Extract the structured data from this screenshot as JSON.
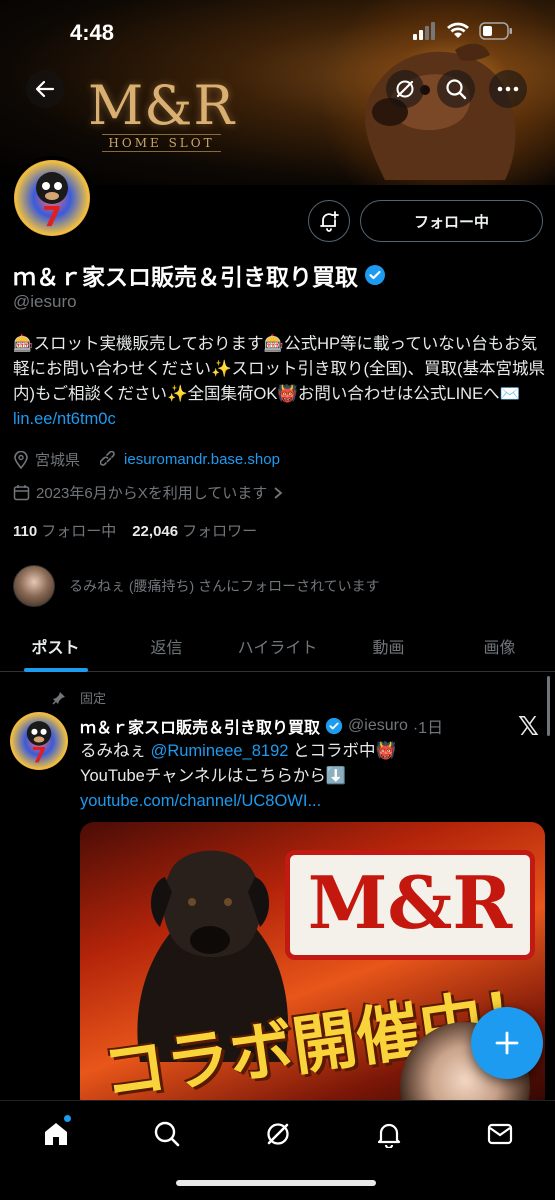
{
  "status_bar": {
    "time": "4:48",
    "battery_icon": "battery-icon",
    "wifi_icon": "wifi-icon",
    "signal_icon": "signal-icon"
  },
  "banner": {
    "logo_main": "M&R",
    "logo_sub": "HOME SLOT"
  },
  "profile": {
    "display_name": "ｍ＆ｒ家スロ販売＆引き取り買取",
    "handle": "@iesuro",
    "following_button": "フォロー中",
    "bio_line1": "🎰スロット実機販売しております🎰公式HP等に載っていない台もお気軽にお問い合わせください✨スロット引き取り(全国)、買取(基本宮城県内)もご相談ください✨全国集荷OK👹お問い合わせは公式LINEへ✉️",
    "bio_link": "lin.ee/nt6tm0c",
    "location": "宮城県",
    "website": "iesuromandr.base.shop",
    "joined": "2023年6月からXを利用しています",
    "following_count": "110",
    "following_label": "フォロー中",
    "followers_count": "22,046",
    "followers_label": "フォロワー",
    "followed_by": "るみねぇ (腰痛持ち) さんにフォローされています"
  },
  "tabs": [
    {
      "label": "ポスト",
      "active": true
    },
    {
      "label": "返信",
      "active": false
    },
    {
      "label": "ハイライト",
      "active": false
    },
    {
      "label": "動画",
      "active": false
    },
    {
      "label": "画像",
      "active": false
    }
  ],
  "post": {
    "pinned_label": "固定",
    "author_name": "ｍ＆ｒ家スロ販売＆引き取り買取",
    "author_handle": "@iesuro",
    "time": "·1日",
    "text_line1_pre": "るみねぇ ",
    "mention": "@Rumineee_8192",
    "text_line1_post": " とコラボ中👹",
    "text_line2": "YouTubeチャンネルはこちらから⬇️",
    "link": "youtube.com/channel/UC8OWI...",
    "image_logo_text": "M&R",
    "image_banner_text": "コラボ開催中！"
  },
  "colors": {
    "accent": "#1d9bf0",
    "background": "#000000",
    "secondary_text": "#71767b"
  },
  "bottom_nav": [
    "home-icon",
    "search-icon",
    "grok-icon",
    "notifications-icon",
    "messages-icon"
  ]
}
